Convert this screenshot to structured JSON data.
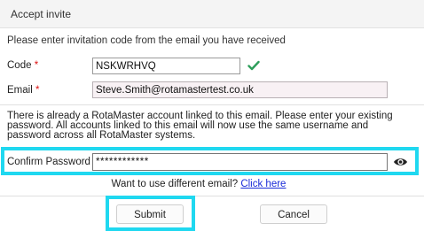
{
  "dialog": {
    "title": "Accept invite",
    "instruction": "Please enter invitation code from the email you have received",
    "code": {
      "label": "Code",
      "required_mark": "*",
      "value": "NSKWRHVQ",
      "valid_icon": "check-icon",
      "valid_color": "#2e9e5b"
    },
    "email": {
      "label": "Email",
      "required_mark": "*",
      "value": "Steve.Smith@rotamastertest.co.uk"
    },
    "notice": "There is already a RotaMaster account linked to this email. Please enter your existing password. All accounts linked to this email will now use the same username and password across all RotaMaster systems.",
    "confirm_password": {
      "label": "Confirm Password",
      "required_mark": "*",
      "value": "************",
      "toggle_icon": "eye-icon"
    },
    "switch_email": {
      "prompt": "Want to use different email?",
      "link": "Click here"
    },
    "buttons": {
      "submit": "Submit",
      "cancel": "Cancel"
    },
    "colors": {
      "highlight": "#1fd8f0",
      "required": "#dd1111",
      "link": "#1a2bd8"
    }
  }
}
